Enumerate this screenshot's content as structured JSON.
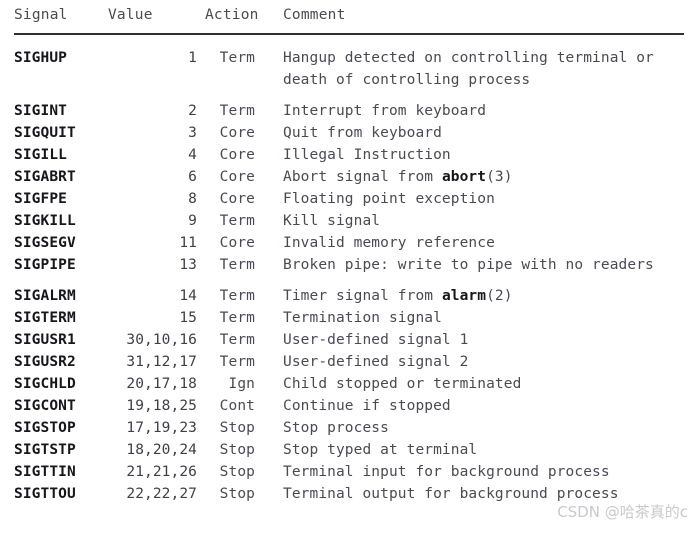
{
  "table": {
    "columns": [
      {
        "key": "signal",
        "label": "Signal"
      },
      {
        "key": "value",
        "label": "Value"
      },
      {
        "key": "action",
        "label": "Action"
      },
      {
        "key": "comment",
        "label": "Comment"
      }
    ],
    "rows": [
      {
        "signal": "SIGHUP",
        "value": "1",
        "action": "Term",
        "comment": "Hangup detected on controlling terminal or death of controlling process",
        "comment_html": "Hangup detected on controlling terminal or death of controlling process",
        "gap_after": true
      },
      {
        "signal": "SIGINT",
        "value": "2",
        "action": "Term",
        "comment": "Interrupt from keyboard",
        "comment_html": "Interrupt from keyboard",
        "gap_after": false
      },
      {
        "signal": "SIGQUIT",
        "value": "3",
        "action": "Core",
        "comment": "Quit from keyboard",
        "comment_html": "Quit from keyboard",
        "gap_after": false
      },
      {
        "signal": "SIGILL",
        "value": "4",
        "action": "Core",
        "comment": "Illegal Instruction",
        "comment_html": "Illegal Instruction",
        "gap_after": false
      },
      {
        "signal": "SIGABRT",
        "value": "6",
        "action": "Core",
        "comment": "Abort signal from abort(3)",
        "comment_html": "Abort signal from <b>abort</b>(3)",
        "gap_after": false
      },
      {
        "signal": "SIGFPE",
        "value": "8",
        "action": "Core",
        "comment": "Floating point exception",
        "comment_html": "Floating point exception",
        "gap_after": false
      },
      {
        "signal": "SIGKILL",
        "value": "9",
        "action": "Term",
        "comment": "Kill signal",
        "comment_html": "Kill signal",
        "gap_after": false
      },
      {
        "signal": "SIGSEGV",
        "value": "11",
        "action": "Core",
        "comment": "Invalid memory reference",
        "comment_html": "Invalid memory reference",
        "gap_after": false
      },
      {
        "signal": "SIGPIPE",
        "value": "13",
        "action": "Term",
        "comment": "Broken pipe: write to pipe with no readers",
        "comment_html": "Broken pipe: write to pipe with no readers",
        "gap_after": true
      },
      {
        "signal": "SIGALRM",
        "value": "14",
        "action": "Term",
        "comment": "Timer signal from alarm(2)",
        "comment_html": "Timer signal from <b>alarm</b>(2)",
        "gap_after": false
      },
      {
        "signal": "SIGTERM",
        "value": "15",
        "action": "Term",
        "comment": "Termination signal",
        "comment_html": "Termination signal",
        "gap_after": false
      },
      {
        "signal": "SIGUSR1",
        "value": "30,10,16",
        "action": "Term",
        "comment": "User-defined signal 1",
        "comment_html": "User-defined signal 1",
        "gap_after": false
      },
      {
        "signal": "SIGUSR2",
        "value": "31,12,17",
        "action": "Term",
        "comment": "User-defined signal 2",
        "comment_html": "User-defined signal 2",
        "gap_after": false
      },
      {
        "signal": "SIGCHLD",
        "value": "20,17,18",
        "action": "Ign",
        "comment": "Child stopped or terminated",
        "comment_html": "Child stopped or terminated",
        "gap_after": false
      },
      {
        "signal": "SIGCONT",
        "value": "19,18,25",
        "action": "Cont",
        "comment": "Continue if stopped",
        "comment_html": "Continue if stopped",
        "gap_after": false
      },
      {
        "signal": "SIGSTOP",
        "value": "17,19,23",
        "action": "Stop",
        "comment": "Stop process",
        "comment_html": "Stop process",
        "gap_after": false
      },
      {
        "signal": "SIGTSTP",
        "value": "18,20,24",
        "action": "Stop",
        "comment": "Stop typed at terminal",
        "comment_html": "Stop typed at terminal",
        "gap_after": false
      },
      {
        "signal": "SIGTTIN",
        "value": "21,21,26",
        "action": "Stop",
        "comment": "Terminal input for background process",
        "comment_html": "Terminal input for background process",
        "gap_after": false
      },
      {
        "signal": "SIGTTOU",
        "value": "22,22,27",
        "action": "Stop",
        "comment": "Terminal output for background process",
        "comment_html": "Terminal output for background process",
        "gap_after": false
      }
    ]
  },
  "watermark": {
    "text": "CSDN @哈茶真的c"
  },
  "colors": {
    "background": "#ffffff",
    "text": "#4a4a55",
    "text_bold": "#16161c",
    "rule": "#2f2f35",
    "watermark": "#c9c9ce"
  }
}
